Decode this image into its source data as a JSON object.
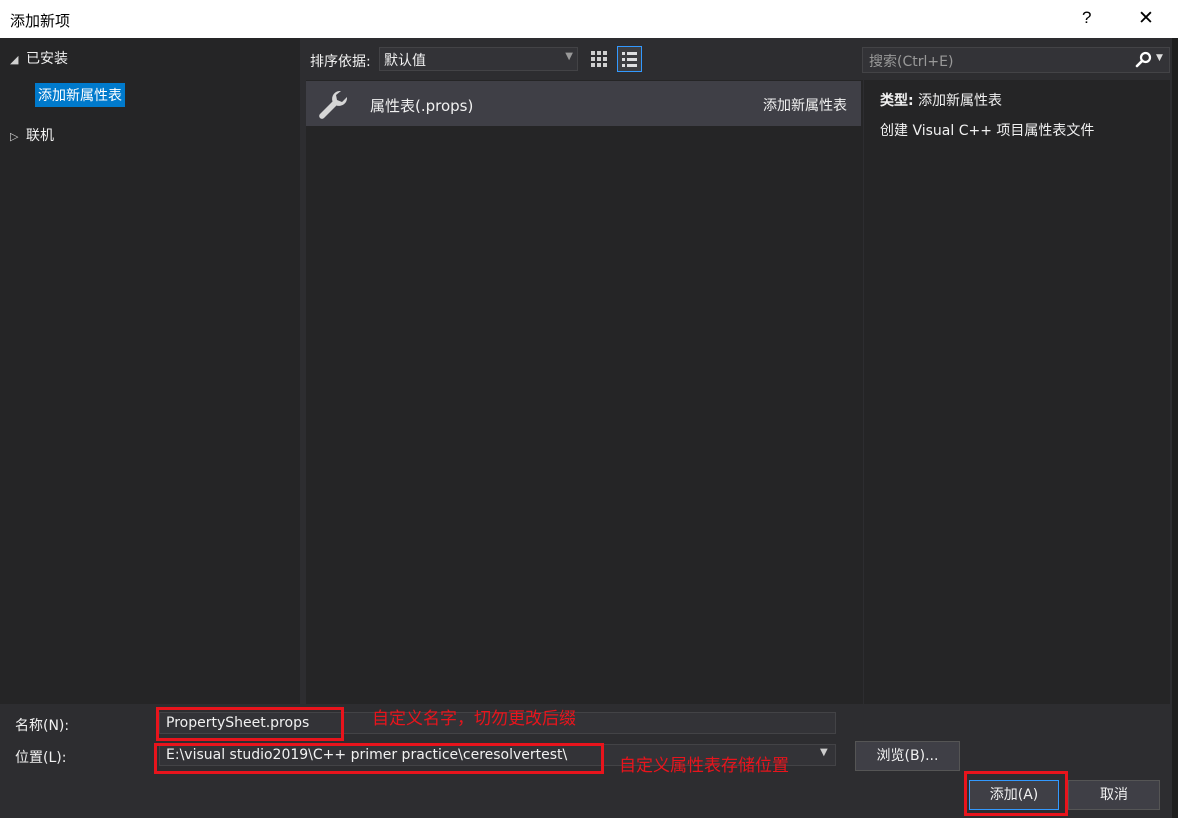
{
  "window": {
    "title": "添加新项",
    "help_label": "?",
    "close_label": "✕"
  },
  "tree": {
    "installed_label": "已安装",
    "installed_child_label": "添加新属性表",
    "online_label": "联机"
  },
  "toolbar": {
    "sort_label": "排序依据:",
    "sort_value": "默认值"
  },
  "templates": [
    {
      "name": "属性表(.props)",
      "type": "添加新属性表",
      "icon": "wrench-icon"
    }
  ],
  "search": {
    "placeholder": "搜索(Ctrl+E)"
  },
  "details": {
    "type_label": "类型:",
    "type_value": "添加新属性表",
    "description": "创建 Visual C++ 项目属性表文件"
  },
  "form": {
    "name_label": "名称(N):",
    "name_value": "PropertySheet.props",
    "location_label": "位置(L):",
    "location_value": "E:\\visual studio2019\\C++ primer practice\\ceresolvertest\\",
    "browse_label": "浏览(B)...",
    "add_label": "添加(A)",
    "cancel_label": "取消"
  },
  "annotations": {
    "name_note": "自定义名字，切勿更改后缀",
    "location_note": "自定义属性表存储位置"
  },
  "colors": {
    "accent": "#007acc",
    "annotation_red": "#e8141c",
    "background": "#2d2d30"
  }
}
